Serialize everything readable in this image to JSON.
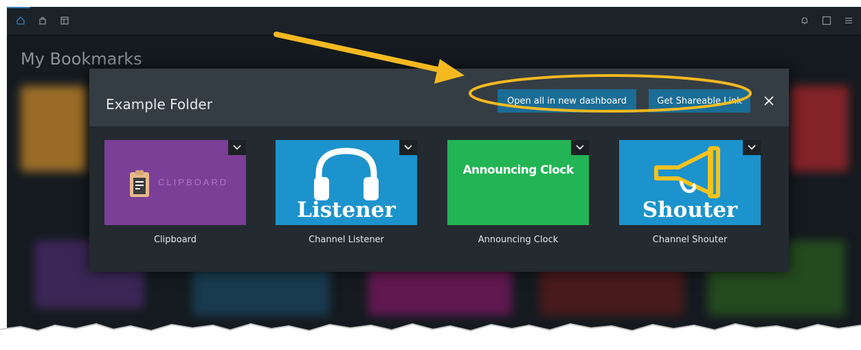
{
  "topbar": {
    "left_icons": [
      "home-icon",
      "shopping-bag-icon",
      "dashboard-layout-icon"
    ],
    "right_icons": [
      "bell-icon",
      "help-icon",
      "hamburger-menu-icon"
    ],
    "help_label": "?"
  },
  "page": {
    "title": "My Bookmarks"
  },
  "modal": {
    "title": "Example Folder",
    "open_all_label": "Open all in new dashboard",
    "share_label": "Get Shareable Link",
    "close_icon": "close-icon"
  },
  "cards": [
    {
      "name": "Clipboard",
      "thumb_text": "CLIPBOARD",
      "color": "#7b3f98"
    },
    {
      "name": "Channel Listener",
      "thumb_text": "Listener",
      "color": "#1c93cc"
    },
    {
      "name": "Announcing Clock",
      "thumb_text": "Announcing Clock",
      "color": "#22b455"
    },
    {
      "name": "Channel Shouter",
      "thumb_text": "Shouter",
      "color": "#1c93cc"
    }
  ],
  "colors": {
    "accent_button": "#1a6d96",
    "annotation_yellow": "#f5b920",
    "modal_bg": "#232a30",
    "modal_header_bg": "#353d44"
  }
}
